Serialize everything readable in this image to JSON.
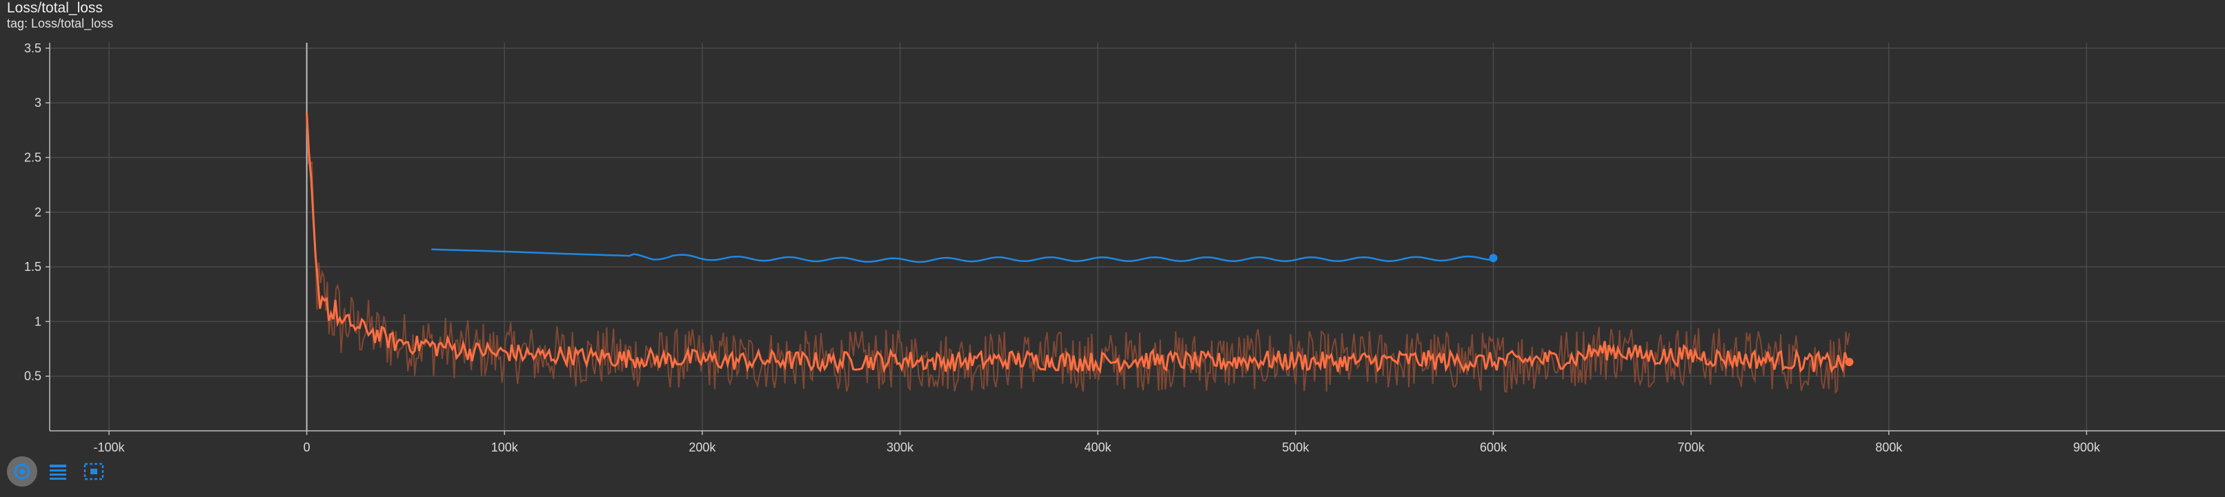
{
  "card": {
    "title": "Loss/total_loss",
    "subtitle": "tag: Loss/total_loss"
  },
  "colors": {
    "background": "#2f2f2f",
    "grid": "#4a4a4a",
    "axis": "#bdbdbd",
    "series_orange": "#ff7043",
    "series_orange_raw": "#8a4a34",
    "series_blue": "#1e88e5",
    "toolbar_icon": "#1e88e5"
  },
  "toolbar": {
    "icons": [
      "fit-domain-icon",
      "data-table-icon",
      "select-region-icon"
    ]
  },
  "chart_data": {
    "type": "line",
    "title": "Loss/total_loss",
    "xlabel": "",
    "ylabel": "",
    "xlim": [
      -130000,
      970000
    ],
    "ylim": [
      0,
      3.55
    ],
    "x_ticks": [
      -100000,
      0,
      100000,
      200000,
      300000,
      400000,
      500000,
      600000,
      700000,
      800000,
      900000
    ],
    "x_tick_labels": [
      "-100k",
      "0",
      "100k",
      "200k",
      "300k",
      "400k",
      "500k",
      "600k",
      "700k",
      "800k",
      "900k"
    ],
    "y_ticks": [
      0.5,
      1,
      1.5,
      2,
      2.5,
      3,
      3.5
    ],
    "y_tick_labels": [
      "0.5",
      "1",
      "1.5",
      "2",
      "2.5",
      "3",
      "3.5"
    ],
    "grid": true,
    "series": [
      {
        "color": "#ff7043",
        "x": [
          0,
          1000,
          3000,
          5000,
          7000,
          9000,
          12000,
          15000,
          18000,
          22000,
          26000,
          30000,
          35000,
          40000,
          45000,
          50000,
          55000,
          60000,
          65000,
          70000,
          75000,
          80000,
          85000,
          90000,
          95000,
          100000,
          110000,
          120000,
          130000,
          140000,
          150000,
          160000,
          170000,
          180000,
          190000,
          200000,
          220000,
          240000,
          260000,
          280000,
          300000,
          320000,
          340000,
          360000,
          380000,
          400000,
          420000,
          440000,
          460000,
          480000,
          500000,
          520000,
          540000,
          560000,
          580000,
          600000,
          620000,
          640000,
          650000,
          660000,
          680000,
          700000,
          720000,
          740000,
          760000,
          770000,
          780000
        ],
        "y": [
          2.8,
          2.55,
          2.0,
          1.35,
          1.2,
          1.25,
          1.05,
          1.1,
          0.95,
          1.0,
          0.92,
          0.95,
          0.88,
          0.85,
          0.8,
          0.82,
          0.78,
          0.8,
          0.76,
          0.78,
          0.75,
          0.74,
          0.72,
          0.74,
          0.7,
          0.72,
          0.7,
          0.68,
          0.7,
          0.67,
          0.68,
          0.66,
          0.67,
          0.65,
          0.66,
          0.65,
          0.64,
          0.65,
          0.63,
          0.64,
          0.65,
          0.63,
          0.64,
          0.65,
          0.64,
          0.63,
          0.65,
          0.64,
          0.63,
          0.65,
          0.64,
          0.63,
          0.64,
          0.65,
          0.64,
          0.63,
          0.65,
          0.66,
          0.72,
          0.74,
          0.68,
          0.69,
          0.66,
          0.65,
          0.63,
          0.62,
          0.63
        ]
      },
      {
        "color": "#1e88e5",
        "x": [
          63000,
          100000,
          130000,
          165000,
          175000,
          185000,
          200000,
          250000,
          300000,
          350000,
          400000,
          450000,
          500000,
          550000,
          600000
        ],
        "y": [
          1.66,
          1.64,
          1.62,
          1.6,
          1.58,
          1.6,
          1.58,
          1.57,
          1.56,
          1.57,
          1.57,
          1.57,
          1.57,
          1.57,
          1.58
        ]
      }
    ]
  }
}
